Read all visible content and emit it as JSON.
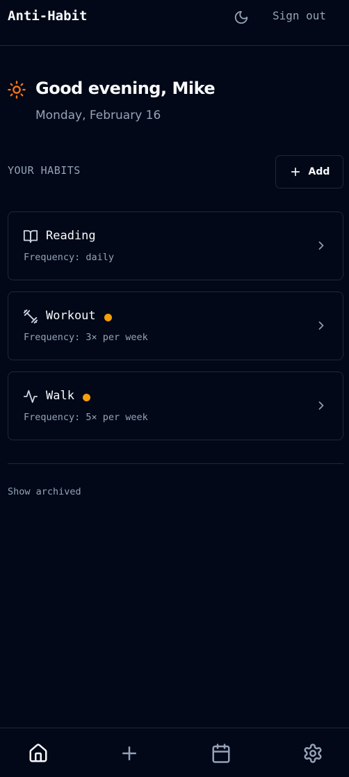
{
  "header": {
    "app_title": "Anti-Habit",
    "theme_icon": "moon-icon",
    "sign_out_label": "Sign out"
  },
  "greeting": {
    "icon": "sun-icon",
    "icon_color": "#f97316",
    "text": "Good evening, Mike",
    "date": "Monday, February 16"
  },
  "habits_section": {
    "label": "YOUR HABITS",
    "add_label": "Add",
    "add_icon": "plus-icon"
  },
  "habits": [
    {
      "name": "Reading",
      "icon": "book-icon",
      "frequency": "Frequency: daily",
      "has_indicator": false
    },
    {
      "name": "Workout",
      "icon": "dumbbell-icon",
      "frequency": "Frequency: 3× per week",
      "has_indicator": true
    },
    {
      "name": "Walk",
      "icon": "activity-icon",
      "frequency": "Frequency: 5× per week",
      "has_indicator": true
    }
  ],
  "indicator_color": "#f59e0b",
  "show_archived_label": "Show archived",
  "bottom_nav": [
    {
      "name": "home",
      "icon": "home-icon",
      "active": true
    },
    {
      "name": "add",
      "icon": "plus-icon",
      "active": false
    },
    {
      "name": "calendar",
      "icon": "calendar-icon",
      "active": false
    },
    {
      "name": "settings",
      "icon": "settings-icon",
      "active": false
    }
  ]
}
